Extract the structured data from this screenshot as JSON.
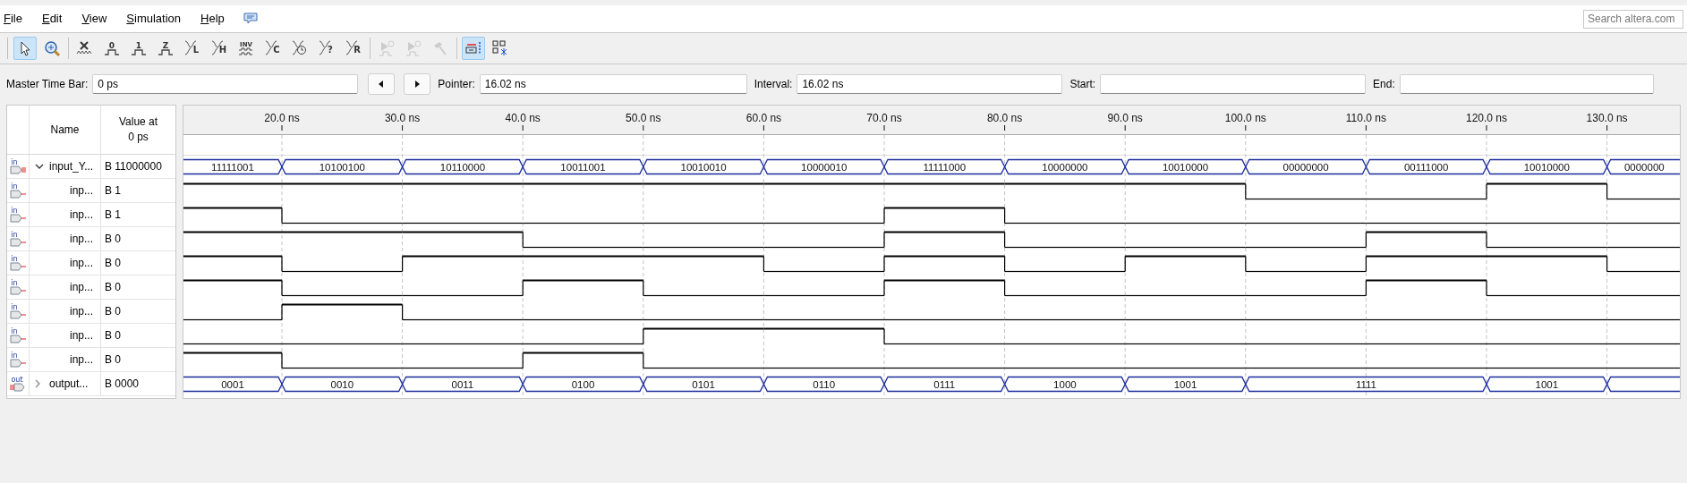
{
  "menu": [
    "File",
    "Edit",
    "View",
    "Simulation",
    "Help"
  ],
  "search": {
    "placeholder": "Search altera.com"
  },
  "toolbar": [
    [
      {
        "kind": "pointer",
        "selected": true,
        "disabled": false
      },
      {
        "kind": "zoom",
        "selected": false,
        "disabled": false
      }
    ],
    [
      {
        "kind": "unknown",
        "selected": false,
        "disabled": false
      },
      {
        "kind": "level",
        "glyph": "0",
        "selected": false,
        "disabled": false
      },
      {
        "kind": "level",
        "glyph": "1",
        "selected": false,
        "disabled": false
      },
      {
        "kind": "level",
        "glyph": "Z",
        "selected": false,
        "disabled": false
      },
      {
        "kind": "cross",
        "glyph": "L",
        "selected": false,
        "disabled": false
      },
      {
        "kind": "cross",
        "glyph": "H",
        "selected": false,
        "disabled": false
      },
      {
        "kind": "invert",
        "glyph": "INV",
        "selected": false,
        "disabled": false
      },
      {
        "kind": "cross",
        "glyph": "C",
        "selected": false,
        "disabled": false
      },
      {
        "kind": "clock",
        "selected": false,
        "disabled": false
      },
      {
        "kind": "cross",
        "glyph": "?",
        "selected": false,
        "disabled": false
      },
      {
        "kind": "cross",
        "glyph": "R",
        "selected": false,
        "disabled": false
      }
    ],
    [
      {
        "kind": "run",
        "selected": false,
        "disabled": true
      },
      {
        "kind": "run",
        "selected": false,
        "disabled": true
      },
      {
        "kind": "hammer",
        "selected": false,
        "disabled": true
      }
    ],
    [
      {
        "kind": "snap",
        "selected": true,
        "disabled": false
      },
      {
        "kind": "grid",
        "selected": false,
        "disabled": false
      }
    ]
  ],
  "time_bar": {
    "master_label": "Master Time Bar:",
    "master_value": "0 ps",
    "pointer_label": "Pointer:",
    "pointer_value": "16.02 ns",
    "interval_label": "Interval:",
    "interval_value": "16.02 ns",
    "start_label": "Start:",
    "end_label": "End:"
  },
  "columns": {
    "name": "Name",
    "value": "Value at 0 ps"
  },
  "ticks": [
    "20.0 ns",
    "30.0 ns",
    "40.0 ns",
    "50.0 ns",
    "60.0 ns",
    "70.0 ns",
    "80.0 ns",
    "90.0 ns",
    "100.0 ns",
    "110.0 ns",
    "120.0 ns",
    "130.0 ns"
  ],
  "signals": [
    {
      "kind": "bus",
      "pin": "in",
      "name": "input_Y...",
      "value": "B 11000000",
      "expanded": true,
      "segments": [
        {
          "value": "11111001"
        },
        {
          "value": "10100100"
        },
        {
          "value": "10110000"
        },
        {
          "value": "10011001"
        },
        {
          "value": "10010010"
        },
        {
          "value": "10000010"
        },
        {
          "value": "11111000"
        },
        {
          "value": "10000000"
        },
        {
          "value": "10010000"
        },
        {
          "value": "00000000"
        },
        {
          "value": "00111000"
        },
        {
          "value": "10010000"
        },
        {
          "value": "0000000"
        }
      ],
      "children": [
        {
          "kind": "bit",
          "pin": "in",
          "name": "inp...",
          "value": "B 1",
          "high": [
            true,
            true,
            true,
            true,
            true,
            true,
            true,
            true,
            true,
            false,
            false,
            true,
            false
          ]
        },
        {
          "kind": "bit",
          "pin": "in",
          "name": "inp...",
          "value": "B 1",
          "high": [
            true,
            false,
            false,
            false,
            false,
            false,
            true,
            false,
            false,
            false,
            false,
            false,
            false
          ]
        },
        {
          "kind": "bit",
          "pin": "in",
          "name": "inp...",
          "value": "B 0",
          "high": [
            true,
            true,
            true,
            false,
            false,
            false,
            true,
            false,
            false,
            false,
            true,
            false,
            false
          ]
        },
        {
          "kind": "bit",
          "pin": "in",
          "name": "inp...",
          "value": "B 0",
          "high": [
            true,
            false,
            true,
            true,
            true,
            false,
            true,
            false,
            true,
            false,
            true,
            true,
            false
          ]
        },
        {
          "kind": "bit",
          "pin": "in",
          "name": "inp...",
          "value": "B 0",
          "high": [
            true,
            false,
            false,
            true,
            false,
            false,
            true,
            false,
            false,
            false,
            true,
            false,
            false
          ]
        },
        {
          "kind": "bit",
          "pin": "in",
          "name": "inp...",
          "value": "B 0",
          "high": [
            false,
            true,
            false,
            false,
            false,
            false,
            false,
            false,
            false,
            false,
            false,
            false,
            false
          ]
        },
        {
          "kind": "bit",
          "pin": "in",
          "name": "inp...",
          "value": "B 0",
          "high": [
            false,
            false,
            false,
            false,
            true,
            true,
            false,
            false,
            false,
            false,
            false,
            false,
            false
          ]
        },
        {
          "kind": "bit",
          "pin": "in",
          "name": "inp...",
          "value": "B 0",
          "high": [
            true,
            false,
            false,
            true,
            false,
            false,
            false,
            false,
            false,
            false,
            false,
            false,
            false
          ]
        }
      ]
    },
    {
      "kind": "bus",
      "pin": "out",
      "name": "output...",
      "value": "B 0000",
      "expanded": false,
      "segments": [
        {
          "value": "0001",
          "wide": false
        },
        {
          "value": "0010",
          "wide": false
        },
        {
          "value": "0011",
          "wide": false
        },
        {
          "value": "0100",
          "wide": false
        },
        {
          "value": "0101",
          "wide": false
        },
        {
          "value": "0110",
          "wide": false
        },
        {
          "value": "0111",
          "wide": false
        },
        {
          "value": "1000",
          "wide": false
        },
        {
          "value": "1001",
          "wide": false
        },
        {
          "value": "1111",
          "wide": true
        },
        {
          "value": "1001",
          "wide": false
        }
      ]
    }
  ]
}
